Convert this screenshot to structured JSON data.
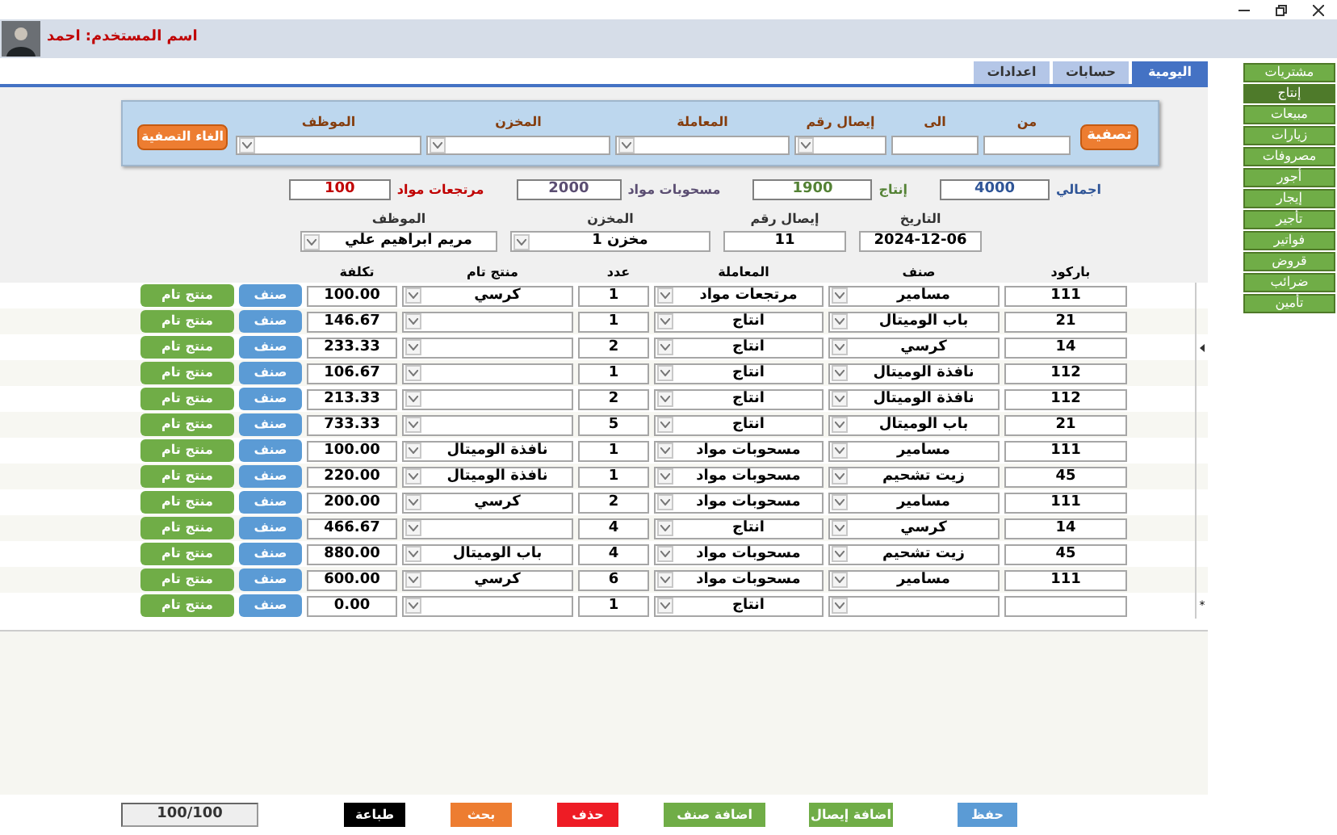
{
  "header": {
    "user_label": "اسم المستخدم: احمد"
  },
  "tabs": [
    {
      "label": "اليومية",
      "selected": true
    },
    {
      "label": "حسابات",
      "selected": false
    },
    {
      "label": "اعدادات",
      "selected": false
    }
  ],
  "side_menu": [
    {
      "label": "مشتريات",
      "selected": false
    },
    {
      "label": "إنتاج",
      "selected": true
    },
    {
      "label": "مبيعات",
      "selected": false
    },
    {
      "label": "زيارات",
      "selected": false
    },
    {
      "label": "مصروفات",
      "selected": false
    },
    {
      "label": "أجور",
      "selected": false
    },
    {
      "label": "إيجار",
      "selected": false
    },
    {
      "label": "تأجير",
      "selected": false
    },
    {
      "label": "فواتير",
      "selected": false
    },
    {
      "label": "قروض",
      "selected": false
    },
    {
      "label": "ضرائب",
      "selected": false
    },
    {
      "label": "تأمين",
      "selected": false
    }
  ],
  "filter": {
    "apply_button": "تصفية",
    "clear_button": "الغاء التصفية",
    "fields": [
      {
        "label": "من",
        "kind": "text"
      },
      {
        "label": "الى",
        "kind": "text"
      },
      {
        "label": "إيصال رقم",
        "kind": "combo"
      },
      {
        "label": "المعاملة",
        "kind": "combo"
      },
      {
        "label": "المخزن",
        "kind": "combo"
      },
      {
        "label": "الموظف",
        "kind": "combo"
      }
    ]
  },
  "summary": [
    {
      "label": "اجمالي",
      "value": "4000",
      "color": "#2f5597"
    },
    {
      "label": "إنتاج",
      "value": "1900",
      "color": "#548235"
    },
    {
      "label": "مسحوبات مواد",
      "value": "2000",
      "color": "#5b4e72"
    },
    {
      "label": "مرتجعات مواد",
      "value": "100",
      "color": "#c00000"
    }
  ],
  "form": [
    {
      "label": "التاريخ",
      "value": "2024-12-06",
      "kind": "text"
    },
    {
      "label": "إيصال رقم",
      "value": "11",
      "kind": "text"
    },
    {
      "label": "المخزن",
      "value": "مخزن 1",
      "kind": "combo"
    },
    {
      "label": "الموظف",
      "value": "مريم ابراهيم علي",
      "kind": "combo"
    }
  ],
  "table": {
    "columns": [
      "باركود",
      "صنف",
      "المعاملة",
      "عدد",
      "منتج تام",
      "تكلفة"
    ],
    "new_row_mark": "*",
    "rows": [
      {
        "barcode": "111",
        "item": "مسامير",
        "transaction": "مرتجعات مواد",
        "count": "1",
        "product": "كرسي",
        "cost": "100.00",
        "item_button": "صنف",
        "product_button": "منتج تام",
        "current": false
      },
      {
        "barcode": "21",
        "item": "باب الوميتال",
        "transaction": "انتاج",
        "count": "1",
        "product": "",
        "cost": "146.67",
        "item_button": "صنف",
        "product_button": "منتج تام",
        "current": false
      },
      {
        "barcode": "14",
        "item": "كرسي",
        "transaction": "انتاج",
        "count": "2",
        "product": "",
        "cost": "233.33",
        "item_button": "صنف",
        "product_button": "منتج تام",
        "current": true
      },
      {
        "barcode": "112",
        "item": "نافذة الوميتال",
        "transaction": "انتاج",
        "count": "1",
        "product": "",
        "cost": "106.67",
        "item_button": "صنف",
        "product_button": "منتج تام",
        "current": false
      },
      {
        "barcode": "112",
        "item": "نافذة الوميتال",
        "transaction": "انتاج",
        "count": "2",
        "product": "",
        "cost": "213.33",
        "item_button": "صنف",
        "product_button": "منتج تام",
        "current": false
      },
      {
        "barcode": "21",
        "item": "باب الوميتال",
        "transaction": "انتاج",
        "count": "5",
        "product": "",
        "cost": "733.33",
        "item_button": "صنف",
        "product_button": "منتج تام",
        "current": false
      },
      {
        "barcode": "111",
        "item": "مسامير",
        "transaction": "مسحوبات مواد",
        "count": "1",
        "product": "نافذة الوميتال",
        "cost": "100.00",
        "item_button": "صنف",
        "product_button": "منتج تام",
        "current": false
      },
      {
        "barcode": "45",
        "item": "زيت تشحيم",
        "transaction": "مسحوبات مواد",
        "count": "1",
        "product": "نافذة الوميتال",
        "cost": "220.00",
        "item_button": "صنف",
        "product_button": "منتج تام",
        "current": false
      },
      {
        "barcode": "111",
        "item": "مسامير",
        "transaction": "مسحوبات مواد",
        "count": "2",
        "product": "كرسي",
        "cost": "200.00",
        "item_button": "صنف",
        "product_button": "منتج تام",
        "current": false
      },
      {
        "barcode": "14",
        "item": "كرسي",
        "transaction": "انتاج",
        "count": "4",
        "product": "",
        "cost": "466.67",
        "item_button": "صنف",
        "product_button": "منتج تام",
        "current": false
      },
      {
        "barcode": "45",
        "item": "زيت تشحيم",
        "transaction": "مسحوبات مواد",
        "count": "4",
        "product": "باب الوميتال",
        "cost": "880.00",
        "item_button": "صنف",
        "product_button": "منتج تام",
        "current": false
      },
      {
        "barcode": "111",
        "item": "مسامير",
        "transaction": "مسحوبات مواد",
        "count": "6",
        "product": "كرسي",
        "cost": "600.00",
        "item_button": "صنف",
        "product_button": "منتج تام",
        "current": false
      },
      {
        "barcode": "",
        "item": "",
        "transaction": "انتاج",
        "count": "1",
        "product": "",
        "cost": "0.00",
        "item_button": "صنف",
        "product_button": "منتج تام",
        "current": false
      }
    ]
  },
  "actions": [
    {
      "label": "حفظ",
      "color": "#5b9bd5"
    },
    {
      "label": "اضافة إيصال",
      "color": "#70ad47"
    },
    {
      "label": "اضافة صنف",
      "color": "#70ad47"
    },
    {
      "label": "حذف",
      "color": "#ee1c25"
    },
    {
      "label": "بحث",
      "color": "#ed7d31"
    },
    {
      "label": "طباعة",
      "color": "#000000"
    }
  ],
  "counter": "100/100"
}
